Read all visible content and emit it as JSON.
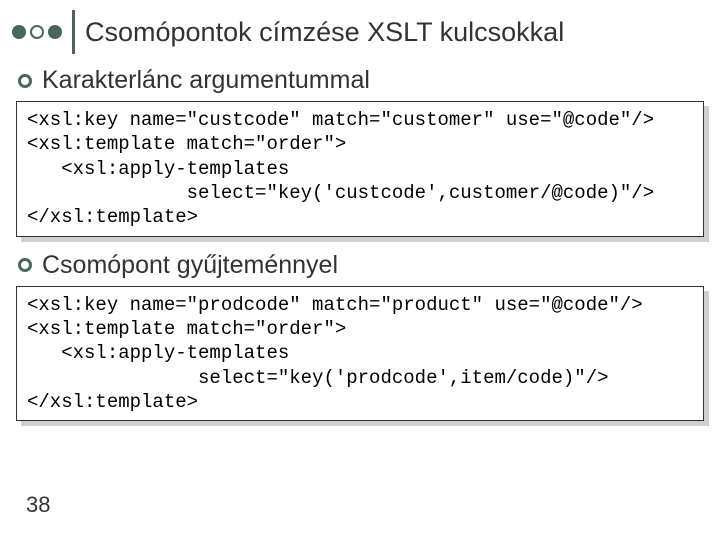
{
  "header": {
    "title": "Csomópontok címzése XSLT kulcsokkal"
  },
  "section1": {
    "heading": "Karakterlánc argumentummal",
    "code": "<xsl:key name=\"custcode\" match=\"customer\" use=\"@code\"/>\n<xsl:template match=\"order\">\n   <xsl:apply-templates\n              select=\"key('custcode',customer/@code)\"/>\n</xsl:template>"
  },
  "section2": {
    "heading": "Csomópont gyűjteménnyel",
    "code": "<xsl:key name=\"prodcode\" match=\"product\" use=\"@code\"/>\n<xsl:template match=\"order\">\n   <xsl:apply-templates\n               select=\"key('prodcode',item/code)\"/>\n</xsl:template>"
  },
  "page_number": "38"
}
